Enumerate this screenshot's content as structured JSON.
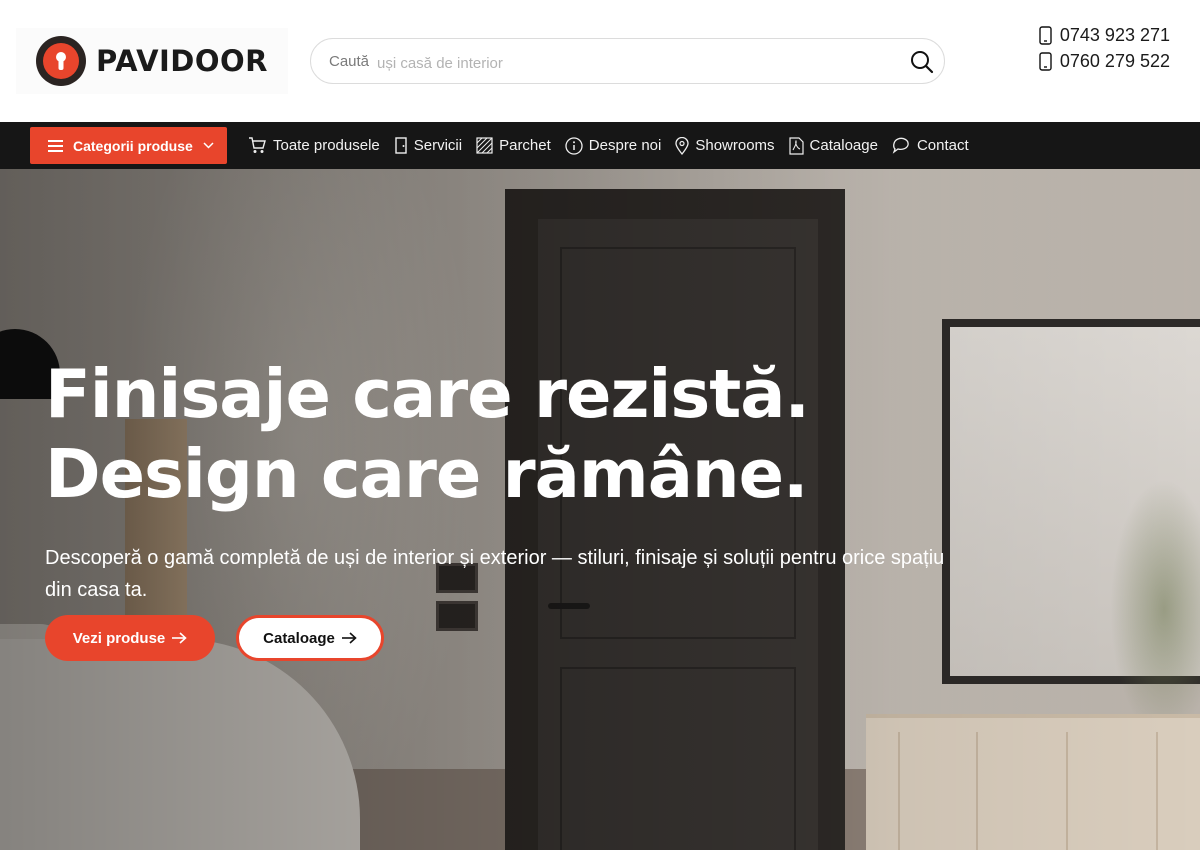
{
  "brand": {
    "name": "PAVIDOOR",
    "accent": "#e8452c",
    "dark": "#161616"
  },
  "search": {
    "label": "Caută",
    "placeholder": "uși casă de interior",
    "icon": "search-icon"
  },
  "phones": [
    "0743 923 271",
    "0760 279 522"
  ],
  "nav": {
    "categories_label": "Categorii produse",
    "items": [
      {
        "label": "Toate produsele",
        "icon": "cart-icon"
      },
      {
        "label": "Servicii",
        "icon": "door-icon"
      },
      {
        "label": "Parchet",
        "icon": "parquet-icon"
      },
      {
        "label": "Despre noi",
        "icon": "info-icon"
      },
      {
        "label": "Showrooms",
        "icon": "map-pin-icon"
      },
      {
        "label": "Cataloage",
        "icon": "pdf-icon"
      },
      {
        "label": "Contact",
        "icon": "chat-icon"
      }
    ]
  },
  "hero": {
    "title_line1": "Finisaje care rezistă.",
    "title_line2": "Design care rămâne.",
    "description": "Descoperă o gamă completă de uși de interior și exterior — stiluri, finisaje și soluții pentru orice spațiu din casa ta.",
    "primary_button": "Vezi produse",
    "secondary_button": "Cataloage"
  }
}
